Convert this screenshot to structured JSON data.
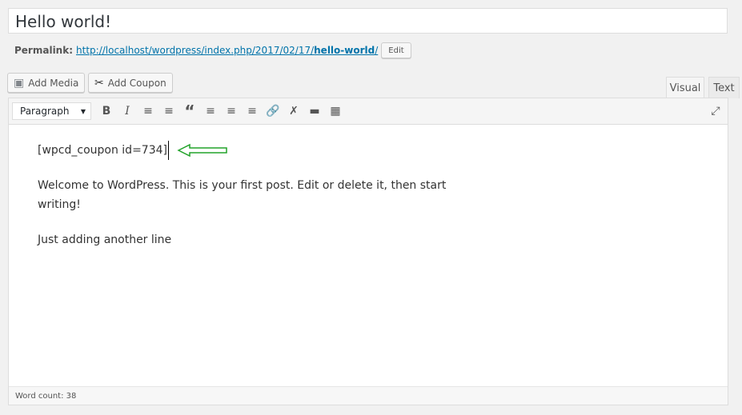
{
  "post": {
    "title": "Hello world!"
  },
  "permalink": {
    "label": "Permalink:",
    "url_prefix": "http://localhost/wordpress/index.php/2017/02/17/",
    "slug": "hello-world",
    "url_suffix": "/",
    "edit_label": "Edit"
  },
  "media_buttons": {
    "add_media": "Add Media",
    "add_coupon": "Add Coupon"
  },
  "tabs": {
    "visual": "Visual",
    "text": "Text"
  },
  "toolbar": {
    "format_select": "Paragraph",
    "buttons": [
      "bold",
      "italic",
      "bulleted-list",
      "numbered-list",
      "blockquote",
      "align-left",
      "align-center",
      "align-right",
      "link",
      "unlink",
      "read-more",
      "toolbar-toggle"
    ]
  },
  "content": {
    "shortcode": "[wpcd_coupon id=734]",
    "para1": "Welcome to WordPress. This is your first post. Edit or delete it, then start",
    "para1b": "writing!",
    "para2": "Just adding another line",
    "arrow_color": "#22a32a"
  },
  "status": {
    "word_count": "Word count: 38"
  }
}
